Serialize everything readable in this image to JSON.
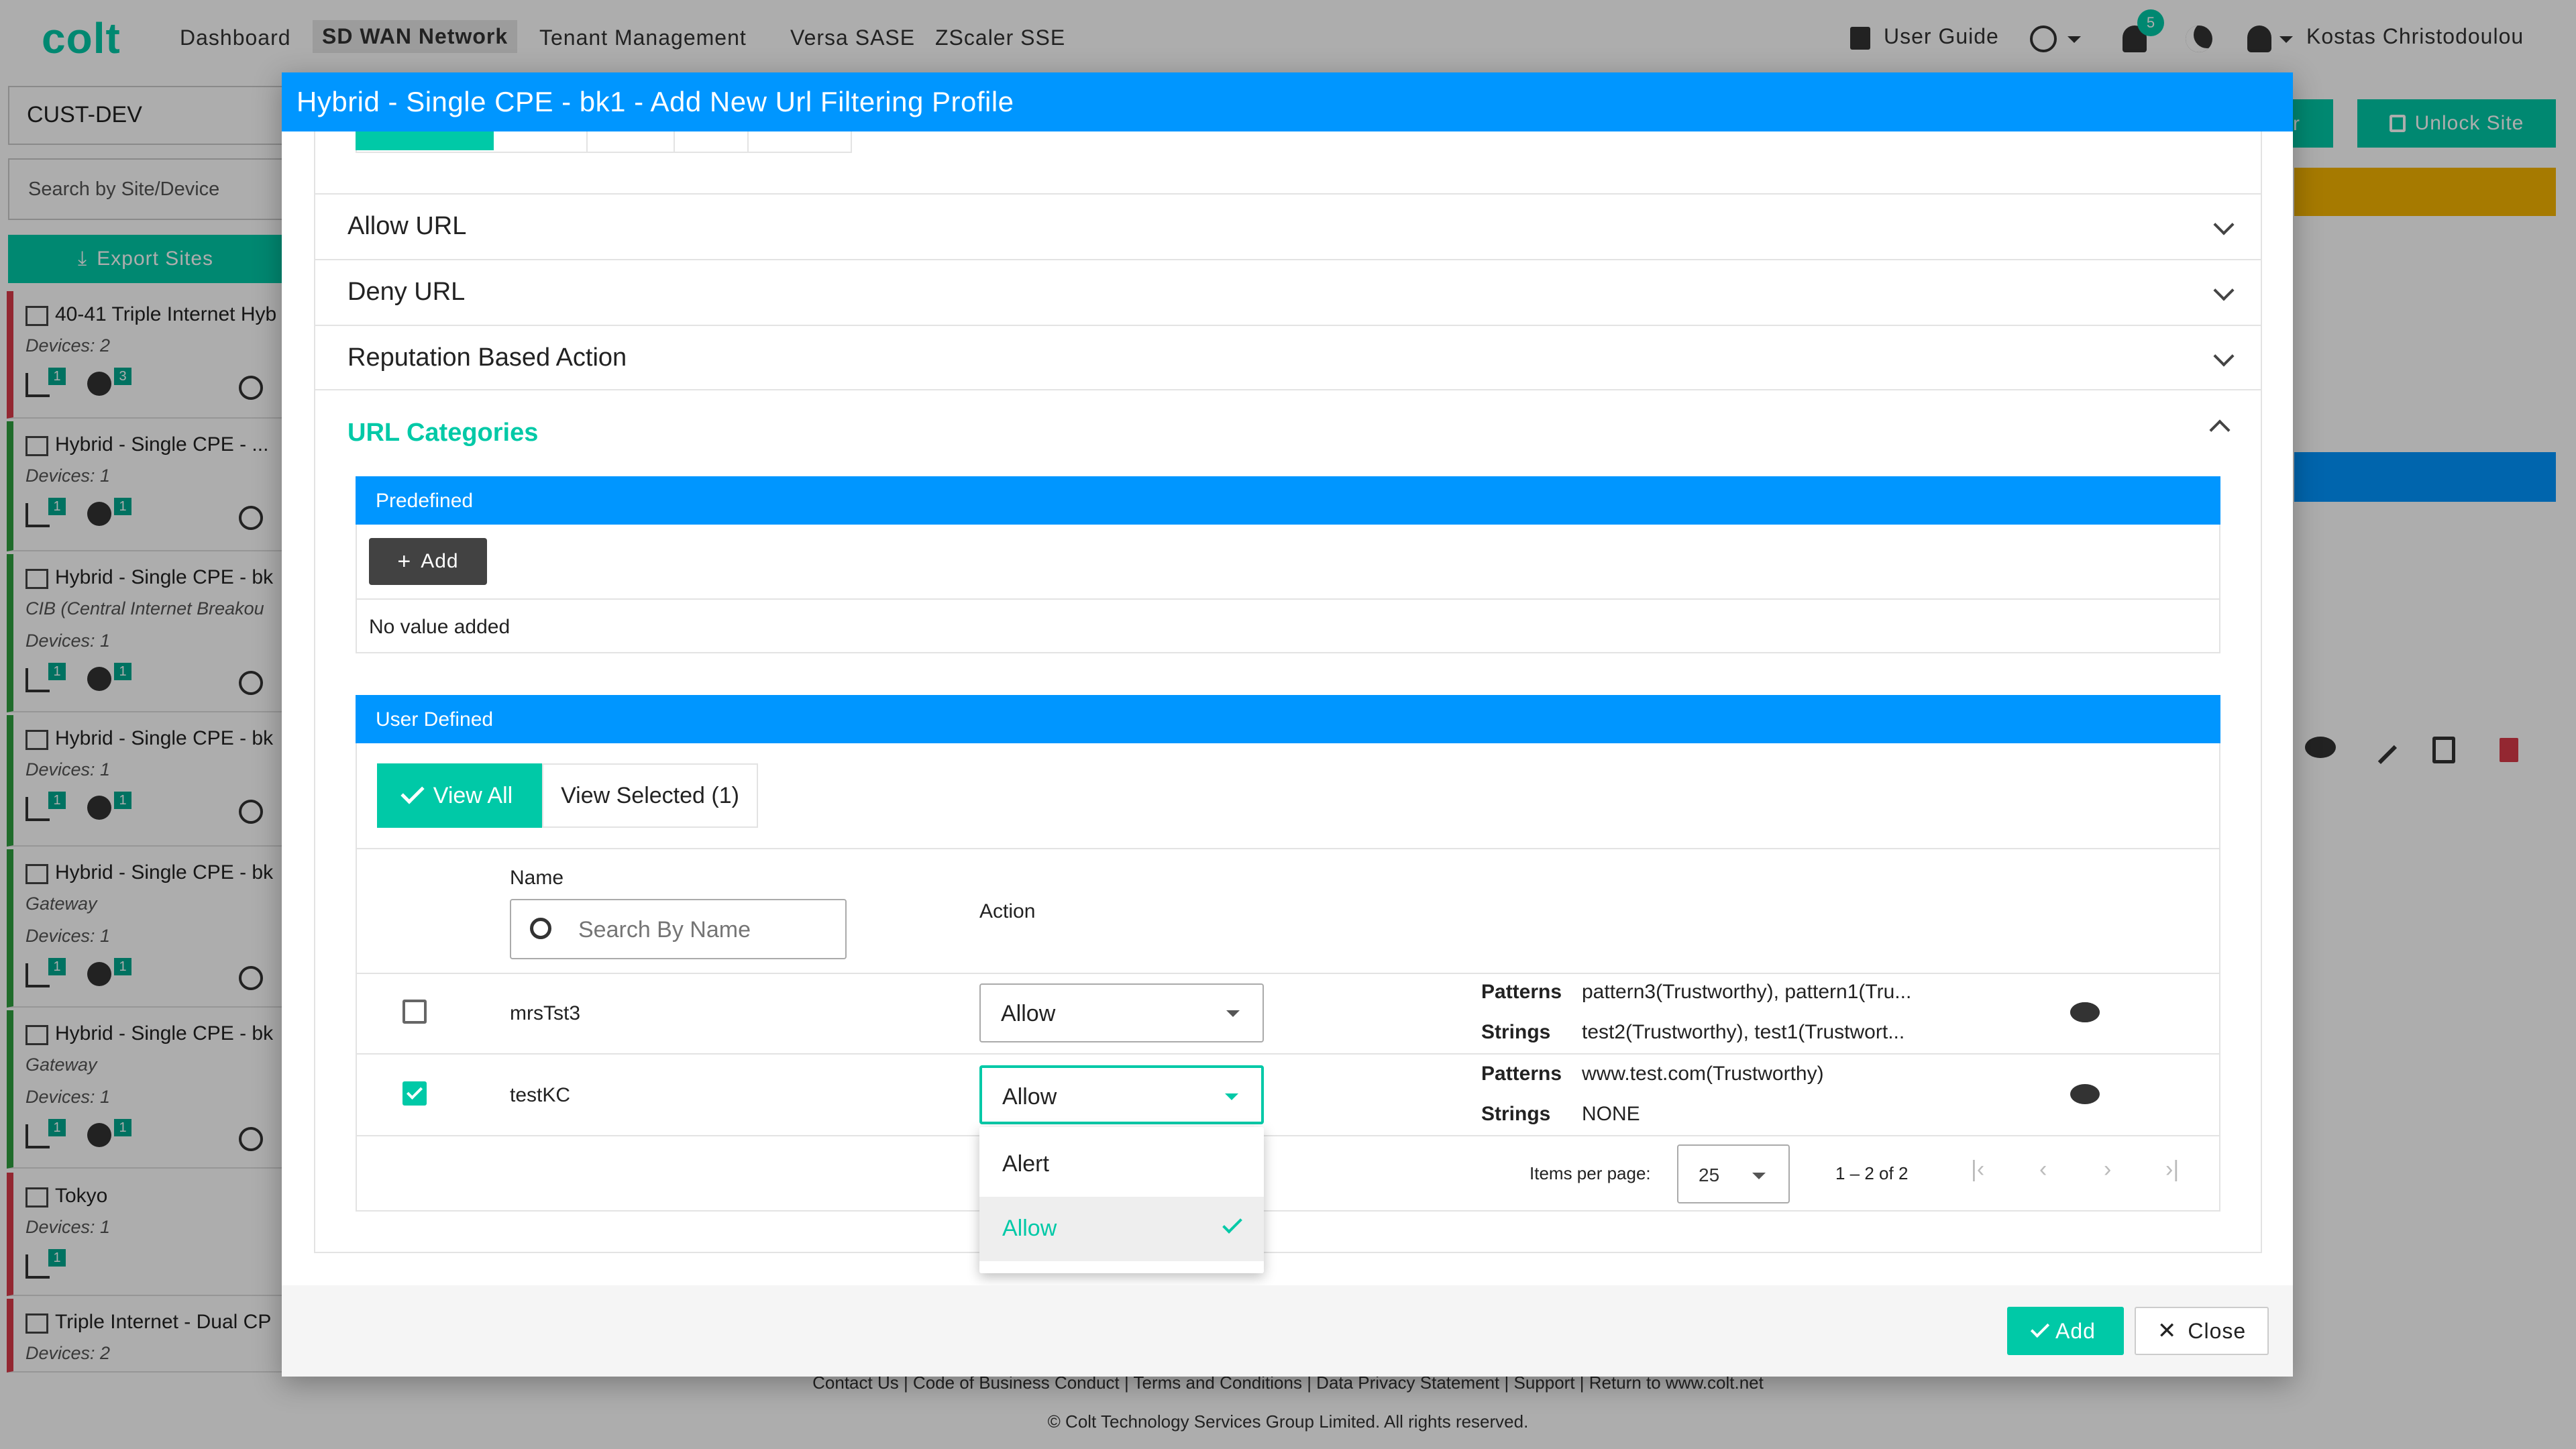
{
  "app": {
    "logo": "colt",
    "nav": [
      "Dashboard",
      "SD WAN Network",
      "Tenant Management",
      "Versa SASE",
      "ZScaler SSE"
    ],
    "active_nav": "SD WAN Network",
    "user_guide": "User Guide",
    "notification_count": "5",
    "user_name": "Kostas Christodoulou"
  },
  "sidebar": {
    "customer": "CUST-DEV",
    "search_placeholder": "Search by Site/Device",
    "export_label": "Export Sites",
    "sites": [
      {
        "title": "40-41 Triple Internet Hyb",
        "sub": "",
        "devices": "Devices: 2",
        "b1": "1",
        "b2": "3",
        "status": "red"
      },
      {
        "title": "Hybrid - Single CPE - ...",
        "sub": "",
        "devices": "Devices: 1",
        "b1": "1",
        "b2": "1",
        "status": "green"
      },
      {
        "title": "Hybrid - Single CPE - bk",
        "sub": "CIB (Central Internet Breakou",
        "devices": "Devices: 1",
        "b1": "1",
        "b2": "1",
        "status": "green"
      },
      {
        "title": "Hybrid - Single CPE - bk",
        "sub": "",
        "devices": "Devices: 1",
        "b1": "1",
        "b2": "1",
        "status": "green"
      },
      {
        "title": "Hybrid - Single CPE - bk",
        "sub": "Gateway",
        "devices": "Devices: 1",
        "b1": "1",
        "b2": "1",
        "status": "green"
      },
      {
        "title": "Hybrid - Single CPE - bk",
        "sub": "Gateway",
        "devices": "Devices: 1",
        "b1": "1",
        "b2": "1",
        "status": "green"
      },
      {
        "title": "Tokyo",
        "sub": "",
        "devices": "Devices: 1",
        "b1": "1",
        "b2": "",
        "status": "red"
      },
      {
        "title": "Triple Internet - Dual CP",
        "sub": "",
        "devices": "Devices: 2",
        "b1": "",
        "b2": "",
        "status": "red"
      }
    ]
  },
  "background": {
    "unlock_label": "Unlock Site",
    "partial_btn": "r"
  },
  "footer": {
    "links": "Contact Us |  Code of Business Conduct |  Terms and Conditions |  Data Privacy Statement |  Support |  Return to www.colt.net",
    "copyright": "© Colt Technology Services Group Limited. All rights reserved."
  },
  "modal": {
    "title": "Hybrid - Single CPE - bk1 - Add New Url Filtering Profile",
    "accordions": [
      "Allow URL",
      "Deny URL",
      "Reputation Based Action"
    ],
    "url_categories": "URL Categories",
    "predefined": {
      "header": "Predefined",
      "add_label": "Add",
      "empty": "No value added"
    },
    "user_defined": {
      "header": "User Defined",
      "view_all": "View All",
      "view_selected": "View Selected (1)",
      "col_name": "Name",
      "col_action": "Action",
      "search_placeholder": "Search By Name",
      "rows": [
        {
          "name": "mrsTst3",
          "checked": false,
          "action": "Allow",
          "patterns_label": "Patterns",
          "patterns": "pattern3(Trustworthy), pattern1(Tru...",
          "strings_label": "Strings",
          "strings": "test2(Trustworthy), test1(Trustwort..."
        },
        {
          "name": "testKC",
          "checked": true,
          "action": "Allow",
          "patterns_label": "Patterns",
          "patterns": "www.test.com(Trustworthy)",
          "strings_label": "Strings",
          "strings": "NONE"
        }
      ],
      "dropdown_options": [
        "Alert",
        "Allow"
      ],
      "dropdown_selected": "Allow",
      "pager": {
        "items_label": "Items per page:",
        "per_page": "25",
        "range": "1 – 2 of 2"
      }
    },
    "footer": {
      "add_label": "Add",
      "close_label": "Close"
    }
  },
  "colors": {
    "accent": "#00c9a7",
    "header_blue": "#0096ff",
    "status_green": "#2e9e3e",
    "status_red": "#d93a49"
  }
}
